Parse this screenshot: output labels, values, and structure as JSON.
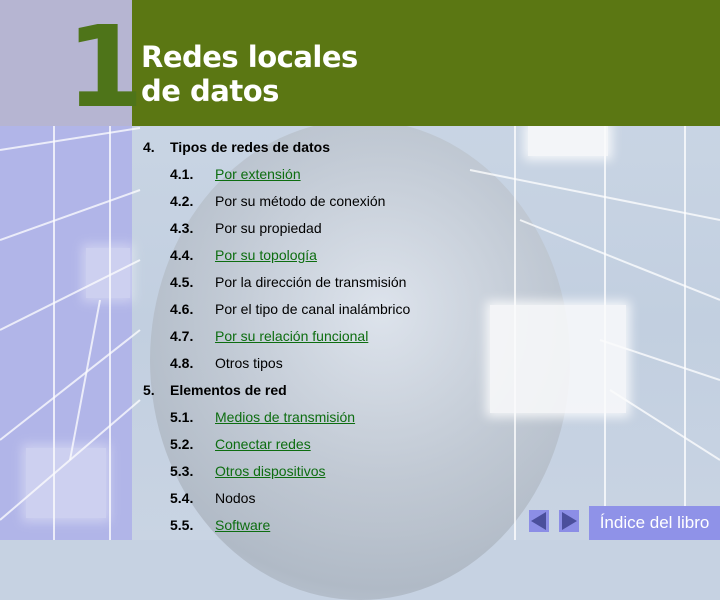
{
  "header": {
    "chapter_number": "1",
    "title_line1": "Redes locales",
    "title_line2": "de datos"
  },
  "toc": {
    "sections": [
      {
        "number": "4.",
        "label": "Tipos de redes de datos",
        "is_link": false,
        "items": [
          {
            "number": "4.1.",
            "label": "Por extensión",
            "is_link": true
          },
          {
            "number": "4.2.",
            "label": "Por su método de conexión",
            "is_link": false
          },
          {
            "number": "4.3.",
            "label": "Por su propiedad",
            "is_link": false
          },
          {
            "number": "4.4.",
            "label": "Por su topología",
            "is_link": true
          },
          {
            "number": "4.5.",
            "label": "Por la dirección de transmisión",
            "is_link": false
          },
          {
            "number": "4.6.",
            "label": "Por el tipo de canal inalámbrico",
            "is_link": false
          },
          {
            "number": "4.7.",
            "label": "Por su relación funcional",
            "is_link": true
          },
          {
            "number": "4.8.",
            "label": "Otros tipos",
            "is_link": false
          }
        ]
      },
      {
        "number": "5.",
        "label": "Elementos de red",
        "is_link": false,
        "items": [
          {
            "number": "5.1.",
            "label": "Medios de transmisión",
            "is_link": true
          },
          {
            "number": "5.2.",
            "label": "Conectar redes",
            "is_link": true
          },
          {
            "number": "5.3.",
            "label": "Otros dispositivos",
            "is_link": true
          },
          {
            "number": "5.4.",
            "label": "Nodos",
            "is_link": false
          },
          {
            "number": "5.5.",
            "label": "Software",
            "is_link": true
          }
        ]
      }
    ]
  },
  "footer": {
    "prev_icon": "triangle-left-icon",
    "next_icon": "triangle-right-icon",
    "index_label": "Índice del libro"
  },
  "colors": {
    "header_green": "#5b7713",
    "chapter_number_green": "#4e7419",
    "link_green": "#0d6d10",
    "left_panel_lavender": "#b1b5e8",
    "nav_button_blue": "#8c8ee6",
    "nav_arrow_dark": "#4b4f9c"
  }
}
